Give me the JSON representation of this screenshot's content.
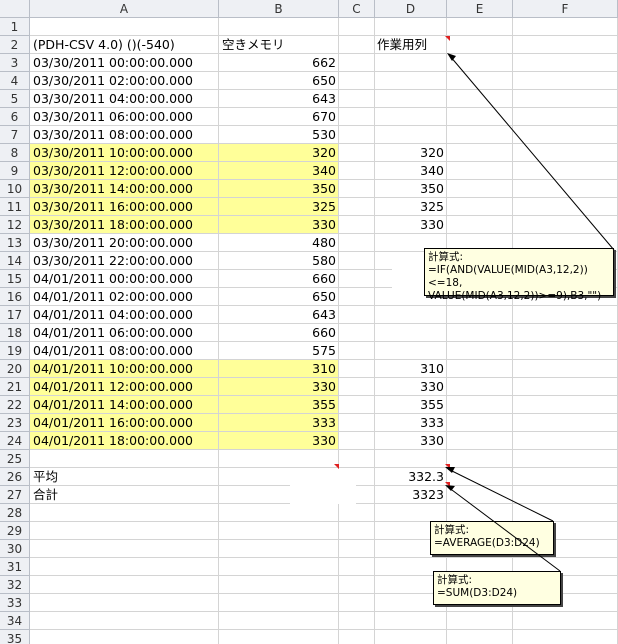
{
  "columns": [
    "A",
    "B",
    "C",
    "D",
    "E",
    "F"
  ],
  "rows": [
    "1",
    "2",
    "3",
    "4",
    "5",
    "6",
    "7",
    "8",
    "9",
    "10",
    "11",
    "12",
    "13",
    "14",
    "15",
    "16",
    "17",
    "18",
    "19",
    "20",
    "21",
    "22",
    "23",
    "24",
    "25",
    "26",
    "27",
    "28",
    "29",
    "30",
    "31",
    "32",
    "33",
    "34",
    "35"
  ],
  "header": {
    "a2": "(PDH-CSV 4.0) ()(-540)",
    "b2": "空きメモリ",
    "d2": "作業用列"
  },
  "data": {
    "timestamps": [
      "03/30/2011 00:00:00.000",
      "03/30/2011 02:00:00.000",
      "03/30/2011 04:00:00.000",
      "03/30/2011 06:00:00.000",
      "03/30/2011 08:00:00.000",
      "03/30/2011 10:00:00.000",
      "03/30/2011 12:00:00.000",
      "03/30/2011 14:00:00.000",
      "03/30/2011 16:00:00.000",
      "03/30/2011 18:00:00.000",
      "03/30/2011 20:00:00.000",
      "03/30/2011 22:00:00.000",
      "04/01/2011 00:00:00.000",
      "04/01/2011 02:00:00.000",
      "04/01/2011 04:00:00.000",
      "04/01/2011 06:00:00.000",
      "04/01/2011 08:00:00.000",
      "04/01/2011 10:00:00.000",
      "04/01/2011 12:00:00.000",
      "04/01/2011 14:00:00.000",
      "04/01/2011 16:00:00.000",
      "04/01/2011 18:00:00.000"
    ],
    "free_memory": [
      "662",
      "650",
      "643",
      "670",
      "530",
      "320",
      "340",
      "350",
      "325",
      "330",
      "480",
      "580",
      "660",
      "650",
      "643",
      "660",
      "575",
      "310",
      "330",
      "355",
      "333",
      "330"
    ],
    "work_col": [
      "",
      "",
      "",
      "",
      "",
      "320",
      "340",
      "350",
      "325",
      "330",
      "",
      "",
      "",
      "",
      "",
      "",
      "",
      "310",
      "330",
      "355",
      "333",
      "330"
    ]
  },
  "summary": {
    "avg_label": "平均",
    "avg_value": "332.3",
    "sum_label": "合計",
    "sum_value": "3323"
  },
  "notes": {
    "note1_title": "計算式:",
    "note1_line1": "=IF(AND(VALUE(MID(A3,12,2))<=18,",
    "note1_line2": "VALUE(MID(A3,12,2))>=9),B3,\"\")",
    "note2_title": "計算式:",
    "note2_line1": "=AVERAGE(D3:D24)",
    "note3_title": "計算式:",
    "note3_line1": "=SUM(D3:D24)"
  }
}
